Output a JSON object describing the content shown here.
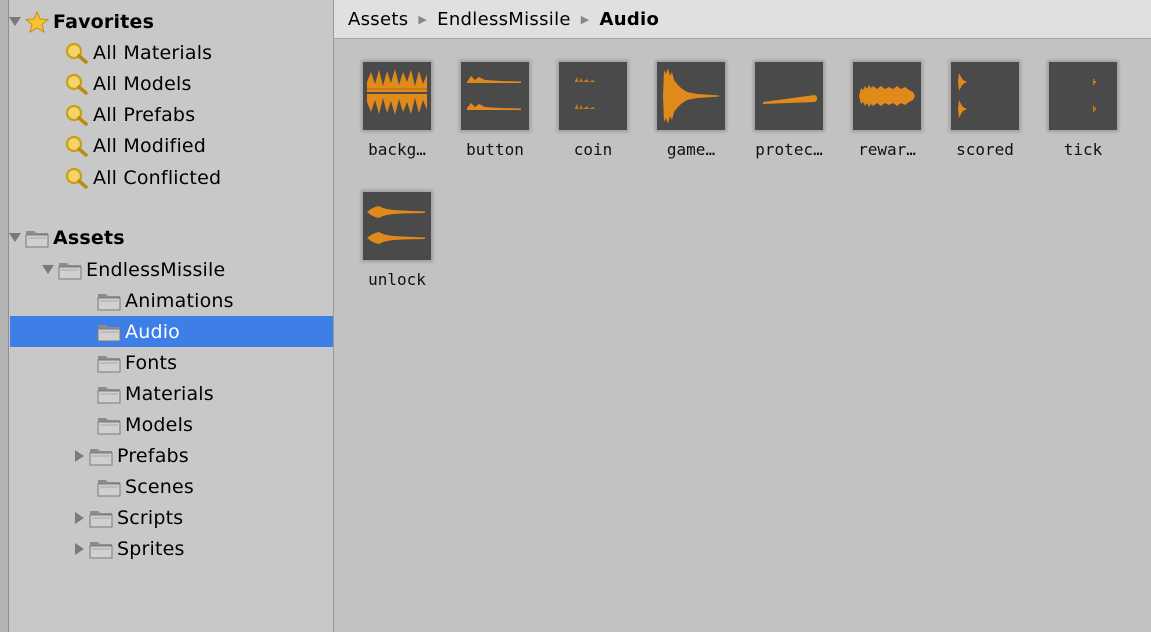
{
  "favorites": {
    "title": "Favorites",
    "items": [
      "All Materials",
      "All Models",
      "All Prefabs",
      "All Modified",
      "All Conflicted"
    ]
  },
  "assets_tree": {
    "root": "Assets",
    "project": "EndlessMissile",
    "folders": [
      {
        "label": "Animations",
        "expandable": false,
        "selected": false
      },
      {
        "label": "Audio",
        "expandable": false,
        "selected": true
      },
      {
        "label": "Fonts",
        "expandable": false,
        "selected": false
      },
      {
        "label": "Materials",
        "expandable": false,
        "selected": false
      },
      {
        "label": "Models",
        "expandable": false,
        "selected": false
      },
      {
        "label": "Prefabs",
        "expandable": true,
        "selected": false
      },
      {
        "label": "Scenes",
        "expandable": false,
        "selected": false
      },
      {
        "label": "Scripts",
        "expandable": true,
        "selected": false
      },
      {
        "label": "Sprites",
        "expandable": true,
        "selected": false
      }
    ]
  },
  "breadcrumb": [
    "Assets",
    "EndlessMissile",
    "Audio"
  ],
  "audio_assets": [
    {
      "label": "backg…",
      "icon": "waveform-dense-stereo"
    },
    {
      "label": "button",
      "icon": "waveform-short-stereo"
    },
    {
      "label": "coin",
      "icon": "waveform-tiny-stereo"
    },
    {
      "label": "game…",
      "icon": "waveform-decay"
    },
    {
      "label": "protec…",
      "icon": "waveform-ramp"
    },
    {
      "label": "rewar…",
      "icon": "waveform-block"
    },
    {
      "label": "scored",
      "icon": "waveform-blip-stereo"
    },
    {
      "label": "tick",
      "icon": "waveform-tick-stereo"
    },
    {
      "label": "unlock",
      "icon": "waveform-swell-stereo"
    }
  ],
  "colors": {
    "selection": "#3d7fe6",
    "waveform": "#e08a1c",
    "thumbnail_bg": "#4a4a4a"
  }
}
